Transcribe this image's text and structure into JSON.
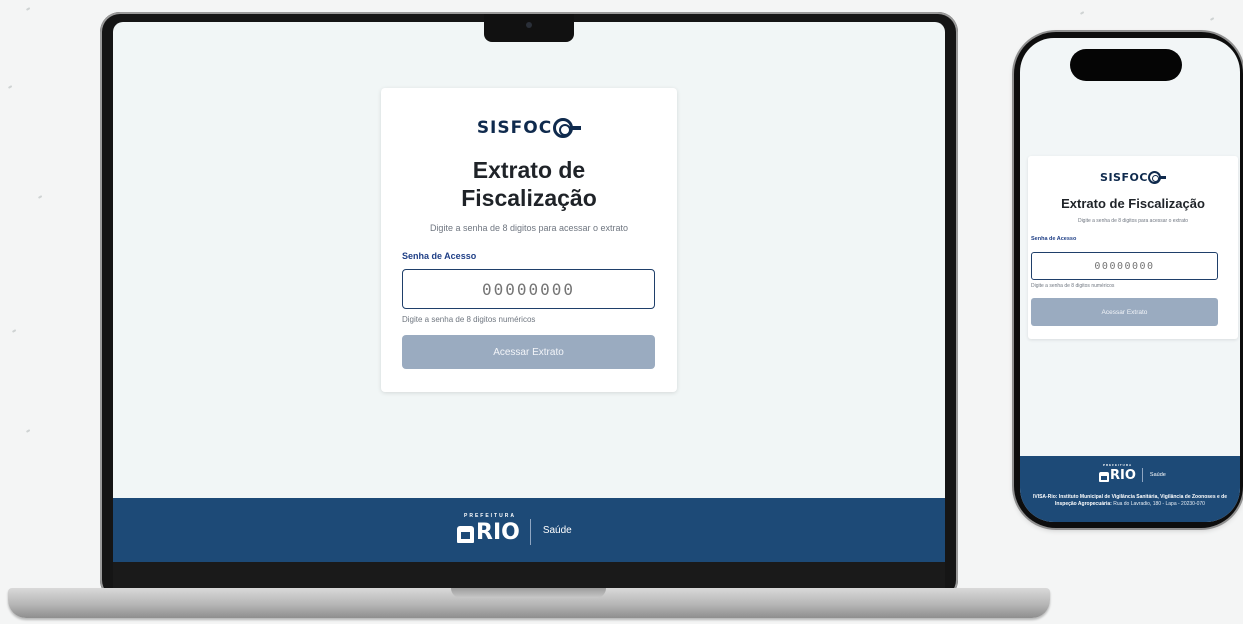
{
  "laptop": {
    "logo_text": "SISFOC",
    "title_line1": "Extrato de",
    "title_line2": "Fiscalização",
    "subtitle": "Digite a senha de 8 digitos para acessar o extrato",
    "password_label": "Senha de Acesso",
    "password_placeholder": "00000000",
    "password_help": "Digite a senha de 8 digitos numéricos",
    "submit_label": "Acessar Extrato",
    "footer": {
      "prefeitura": "PREFEITURA",
      "rio": "RIO",
      "saude": "Saúde"
    }
  },
  "phone": {
    "logo_text": "SISFOC",
    "title": "Extrato de Fiscalização",
    "subtitle": "Digite a senha de 8 digitos para acessar o extrato",
    "password_label": "Senha de Acesso",
    "password_placeholder": "00000000",
    "password_help": "Digite a senha de 8 digitos numéricos",
    "submit_label": "Acessar Extrato",
    "footer": {
      "prefeitura": "PREFEITURA",
      "rio": "RIO",
      "saude": "Saúde",
      "address_bold": "IVISA-Rio: Instituto Municipal de Vigilância Sanitária, Vigilância de Zoonoses e de Inspeção Agropecuária:",
      "address_rest": "Rua do Lavradio, 180 - Lapa - 20230-070"
    }
  },
  "colors": {
    "brand_navy": "#0f2a4d",
    "footer_blue": "#1d4a77",
    "button_disabled": "#9aabc0",
    "label_blue": "#1f3f86"
  }
}
